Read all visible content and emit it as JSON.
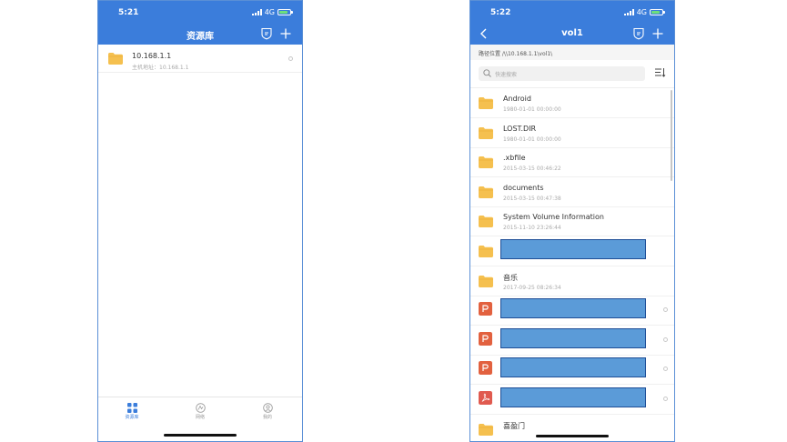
{
  "left": {
    "status": {
      "time": "5:21",
      "network": "4G"
    },
    "header": {
      "title": "资源库"
    },
    "hosts": [
      {
        "name": "10.168.1.1",
        "address": "主机地址：10.168.1.1"
      }
    ],
    "tabs": [
      {
        "label": "资源库"
      },
      {
        "label": "网络"
      },
      {
        "label": "我的"
      }
    ]
  },
  "right": {
    "status": {
      "time": "5:22",
      "network": "4G"
    },
    "header": {
      "title": "vol1"
    },
    "path": "路径位置 /\\\\10.168.1.1\\vol1\\",
    "search": {
      "placeholder": "快速搜索"
    },
    "files": [
      {
        "name": "Android",
        "date": "1980-01-01 00:00:00",
        "icon": "folder-icon"
      },
      {
        "name": "LOST.DIR",
        "date": "1980-01-01 00:00:00",
        "icon": "folder-icon"
      },
      {
        "name": ".xbfile",
        "date": "2015-03-15 00:46:22",
        "icon": "folder-icon"
      },
      {
        "name": "documents",
        "date": "2015-03-15 00:47:38",
        "icon": "folder-icon"
      },
      {
        "name": "System Volume Information",
        "date": "2015-11-10 23:26:44",
        "icon": "folder-icon"
      },
      {
        "name": "",
        "date": "",
        "icon": "folder-icon",
        "redacted": true
      },
      {
        "name": "音乐",
        "date": "2017-09-25 08:26:34",
        "icon": "folder-icon"
      },
      {
        "name": "",
        "date": "",
        "icon": "ppt-icon",
        "redacted": true
      },
      {
        "name": "",
        "date": "",
        "icon": "ppt-icon",
        "redacted": true
      },
      {
        "name": "",
        "date": "",
        "icon": "ppt-icon",
        "redacted": true
      },
      {
        "name": "",
        "date": "",
        "icon": "pdf-icon",
        "redacted": true
      },
      {
        "name": "喜盈门",
        "date": "",
        "icon": "folder-icon"
      }
    ]
  },
  "colors": {
    "header": "#3b7ddb",
    "folder": "#f5c04f",
    "ppt": "#e2613f",
    "pdf": "#e05a4f",
    "redaction": "#5b9bd8"
  }
}
